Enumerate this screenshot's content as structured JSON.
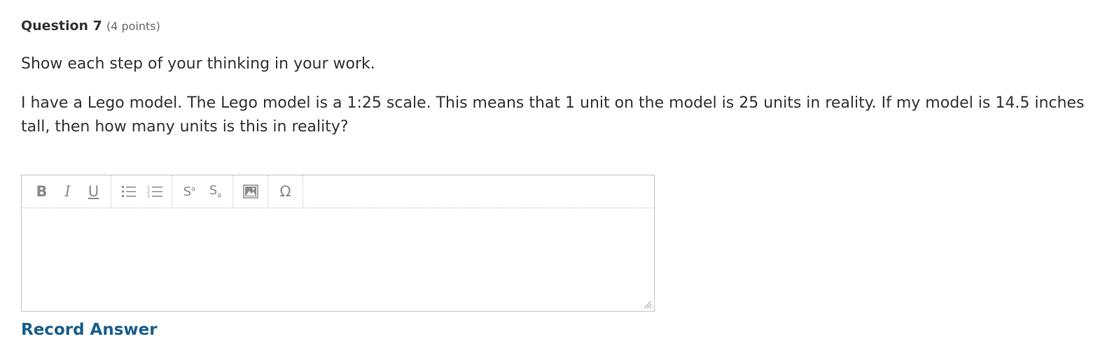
{
  "question": {
    "title": "Question 7",
    "points": "(4 points)"
  },
  "instructions": "Show each step of your thinking in your work.",
  "prompt": "I have a Lego model. The Lego model is a 1:25 scale. This means that 1 unit on the model is 25 units in reality. If my model is 14.5 inches tall, then how many units is this in reality?",
  "editor": {
    "toolbar": {
      "bold": "B",
      "italic": "I",
      "underline": "U",
      "superscript_base": "S",
      "superscript_mark": "a",
      "subscript_base": "S",
      "subscript_mark": "a",
      "special_char": "Ω"
    },
    "icons": {
      "bullet_list": "bulleted-list-icon",
      "numbered_list": "numbered-list-icon",
      "image": "image-icon",
      "resize": "resize-grip-icon"
    },
    "value": ""
  },
  "record_answer_label": "Record Answer",
  "colors": {
    "text": "#333333",
    "muted": "#6a6a6a",
    "link": "#1a5e8b",
    "border": "#c4c4c4",
    "toolbar_icon": "#8a8a8a"
  }
}
